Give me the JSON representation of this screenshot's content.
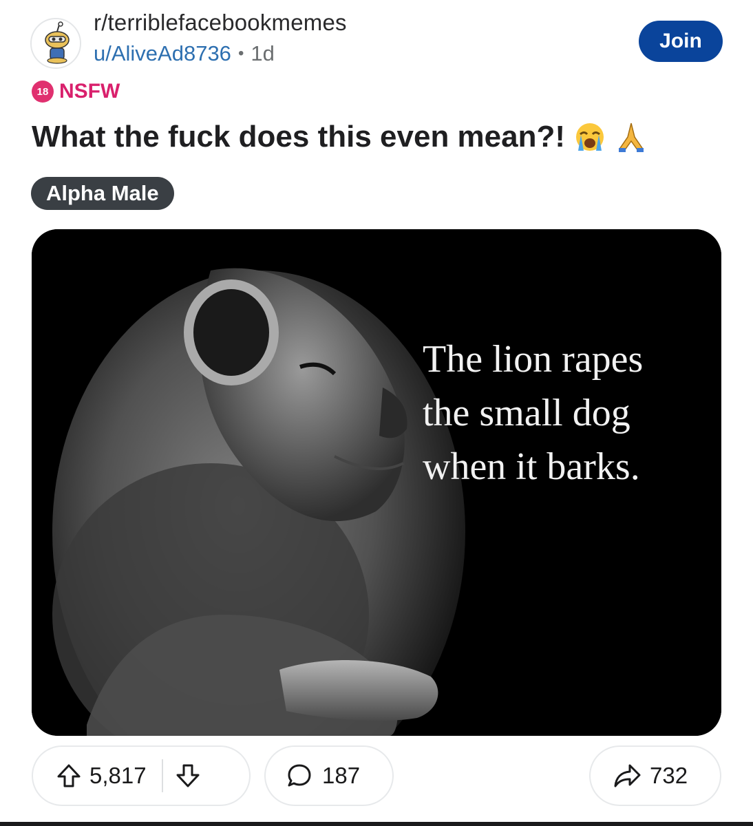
{
  "header": {
    "subreddit": "r/terriblefacebookmemes",
    "user": "u/AliveAd8736",
    "separator": "•",
    "age": "1d",
    "join_label": "Join"
  },
  "nsfw": {
    "badge": "18",
    "label": "NSFW",
    "color": "#d9206c"
  },
  "post": {
    "title": "What the fuck does this even mean?!",
    "emojis": [
      "loudly-crying-face-icon",
      "folded-hands-icon"
    ],
    "flair": "Alpha Male"
  },
  "media": {
    "caption_lines": [
      "The lion rapes",
      "the small dog",
      "when it barks."
    ]
  },
  "actions": {
    "upvotes": "5,817",
    "comments": "187",
    "shares": "732"
  },
  "colors": {
    "join": "#0a449b",
    "user_link": "#2d6fb0",
    "flair_bg": "#3a3f44"
  }
}
